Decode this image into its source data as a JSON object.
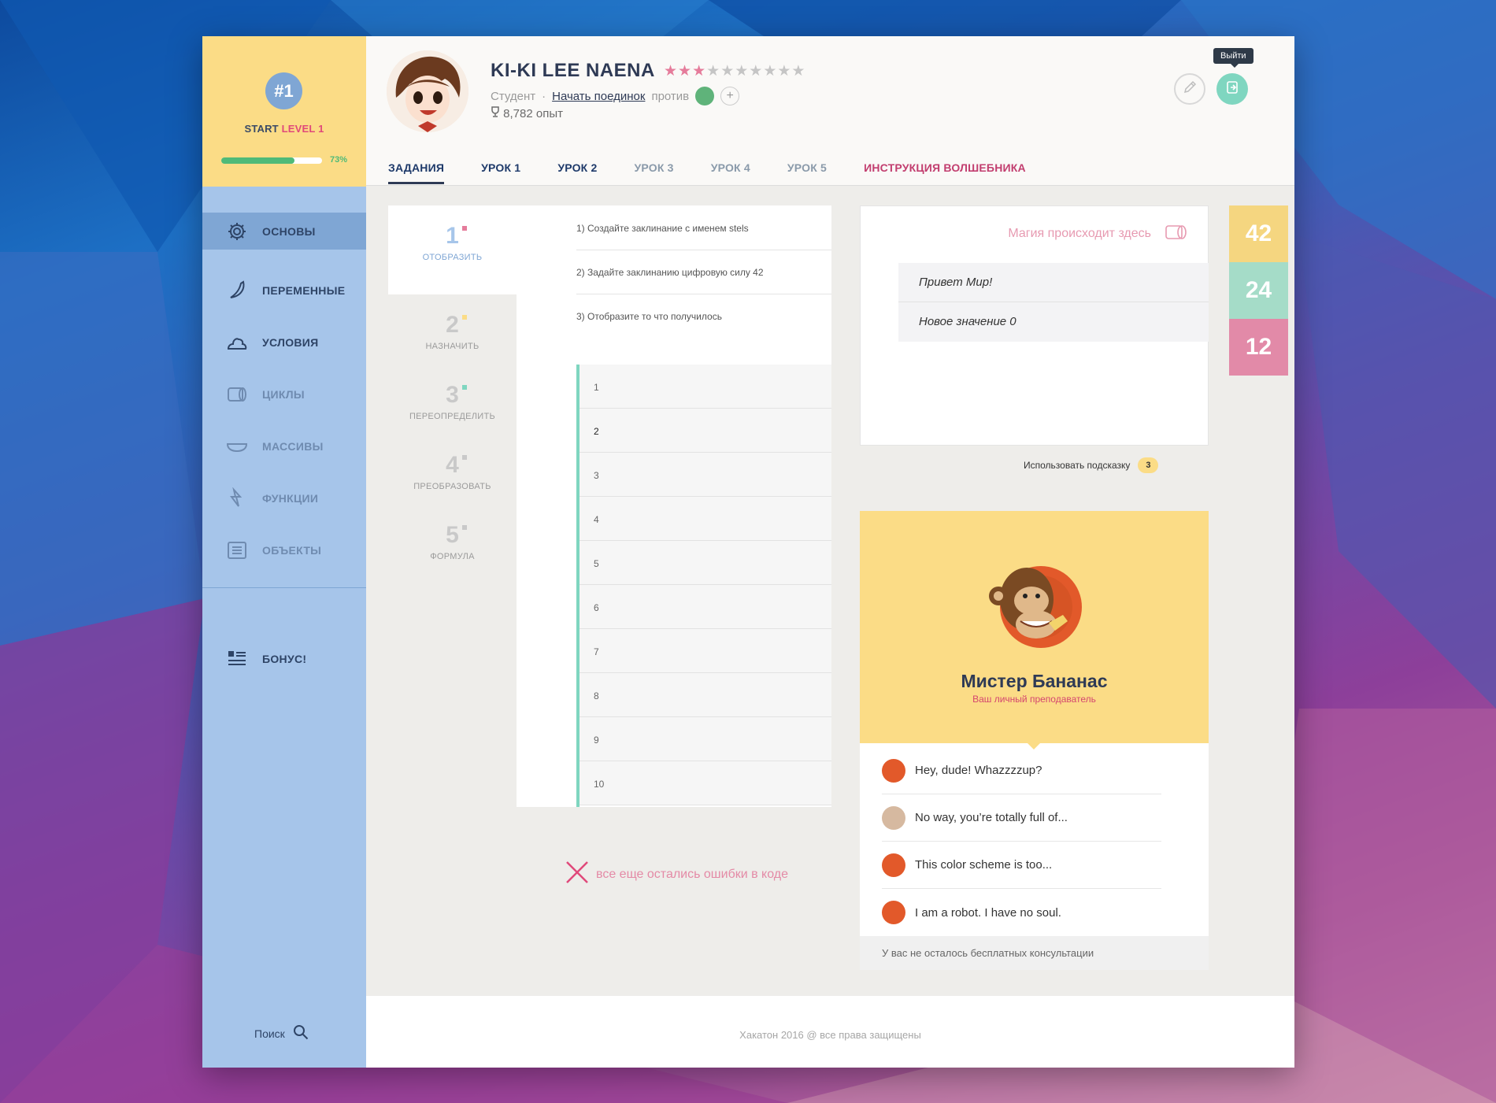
{
  "sidebar": {
    "level_rank": "#1",
    "level_prefix": "START ",
    "level_label": "LEVEL 1",
    "progress": 0.73,
    "progress_text": "73%",
    "items": [
      {
        "label": "ОСНОВЫ",
        "icon": "gear-icon",
        "active": true
      },
      {
        "label": "ПЕРЕМЕННЫЕ",
        "icon": "banana-icon"
      },
      {
        "label": "УСЛОВИЯ",
        "icon": "cream-icon"
      },
      {
        "label": "ЦИКЛЫ",
        "icon": "toilet-paper-icon"
      },
      {
        "label": "МАССИВЫ",
        "icon": "cup-icon"
      },
      {
        "label": "ФУНКЦИИ",
        "icon": "lightning-icon"
      },
      {
        "label": "ОБЪЕКТЫ",
        "icon": "list-icon"
      }
    ],
    "bonus": {
      "label": "БОНУС!",
      "icon": "bonus-list-icon"
    },
    "search_label": "Поиск"
  },
  "header": {
    "username": "KI-KI LEE NAENA",
    "rating": {
      "filled": 3,
      "total": 10
    },
    "role": "Студент",
    "separator": "·",
    "duel_link": "Начать поединок",
    "against": "против",
    "xp": "8,782 опыт",
    "logout_tooltip": "Выйти"
  },
  "tabs": [
    {
      "label": "ЗАДАНИЯ",
      "state": "active"
    },
    {
      "label": "УРОК 1",
      "state": "normal"
    },
    {
      "label": "УРОК 2",
      "state": "normal"
    },
    {
      "label": "УРОК 3",
      "state": "muted"
    },
    {
      "label": "УРОК 4",
      "state": "muted"
    },
    {
      "label": "УРОК 5",
      "state": "muted"
    },
    {
      "label": "ИНСТРУКЦИЯ ВОЛШЕБНИКА",
      "state": "accent"
    }
  ],
  "steps": [
    {
      "num": "1",
      "label": "ОТОБРАЗИТЬ",
      "dot": "#e57c9b",
      "active": true
    },
    {
      "num": "2",
      "label": "НАЗНАЧИТЬ",
      "dot": "#fbdc86"
    },
    {
      "num": "3",
      "label": "ПЕРЕОПРЕДЕЛИТЬ",
      "dot": "#7fd6c0"
    },
    {
      "num": "4",
      "label": "ПРЕОБРАЗОВАТЬ",
      "dot": "#c9c9c9"
    },
    {
      "num": "5",
      "label": "ФОРМУЛА",
      "dot": "#c9c9c9"
    }
  ],
  "tasks": [
    "1) Создайте заклинание с именем stels",
    "2) Задайте заклинанию цифровую силу 42",
    "3) Отобразите то что получилось"
  ],
  "editor_lines": [
    "1",
    "2",
    "3",
    "4",
    "5",
    "6",
    "7",
    "8",
    "9",
    "10"
  ],
  "current_line": 2,
  "error_text": "все еще остались ошибки в коде",
  "output": {
    "title": "Магия происходит здесь",
    "lines": [
      "Привет Мир!",
      "Новое значение 0"
    ]
  },
  "hint": {
    "label": "Использовать подсказку",
    "count": "3"
  },
  "scores": [
    {
      "value": "42",
      "color": "#f5d680"
    },
    {
      "value": "24",
      "color": "#a5dcc8"
    },
    {
      "value": "12",
      "color": "#e28aa8"
    }
  ],
  "mentor": {
    "name": "Мистер Бананас",
    "role": "Ваш личный преподаватель",
    "messages": [
      {
        "text": "Hey, dude! Whazzzzup?",
        "from": "mentor"
      },
      {
        "text": "No way, you’re totally full of...",
        "from": "user"
      },
      {
        "text": "This color scheme is too...",
        "from": "mentor"
      },
      {
        "text": "I am a robot. I have no soul.",
        "from": "mentor"
      }
    ],
    "footer": "У вас не осталось бесплатных консультации"
  },
  "footer": "Хакатон 2016 @ все права защищены"
}
